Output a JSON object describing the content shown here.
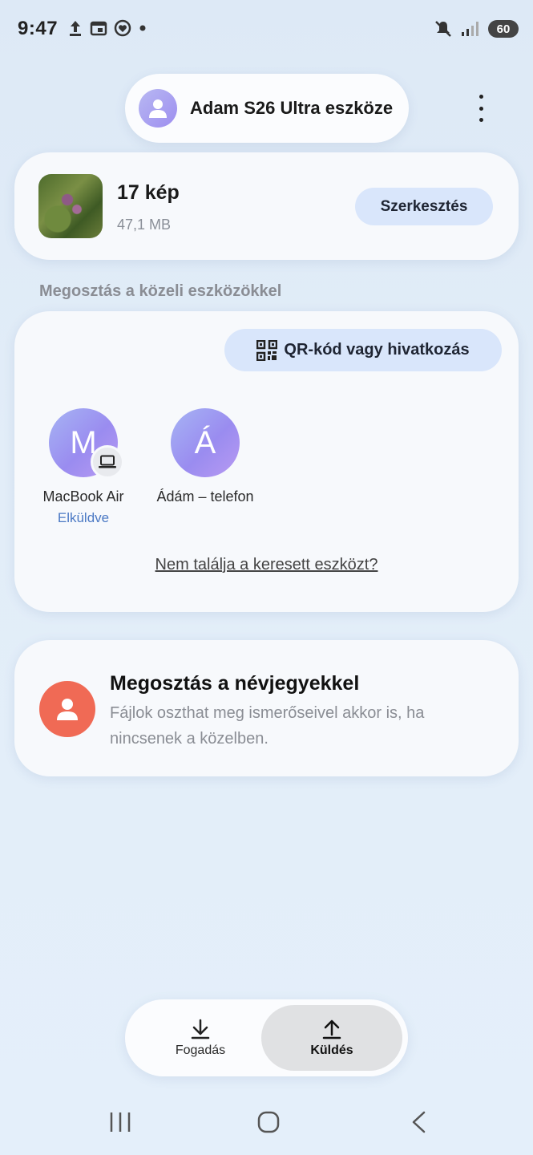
{
  "status_bar": {
    "time": "9:47",
    "battery": "60"
  },
  "header": {
    "device_name": "Adam S26 Ultra eszköze"
  },
  "share_summary": {
    "count_label": "17 kép",
    "size_label": "47,1 MB",
    "edit_label": "Szerkesztés"
  },
  "nearby": {
    "section_label": "Megosztás a közeli eszközökkel",
    "qr_label": "QR-kód vagy hivatkozás",
    "devices": [
      {
        "initial": "M",
        "name": "MacBook Air",
        "status": "Elküldve",
        "type": "laptop"
      },
      {
        "initial": "Á",
        "name": "Ádám – telefon",
        "status": "",
        "type": "phone"
      }
    ],
    "not_found_label": "Nem találja a keresett eszközt?"
  },
  "contacts": {
    "title": "Megosztás a névjegyekkel",
    "description": "Fájlok oszthat meg ismerőseivel akkor is, ha nincsenek a közelben."
  },
  "bottom_nav": {
    "receive_label": "Fogadás",
    "send_label": "Küldés",
    "active": "send"
  },
  "colors": {
    "accent_button": "#d9e6fb",
    "contact_icon": "#f06a55",
    "sent_status": "#4b79c4"
  }
}
